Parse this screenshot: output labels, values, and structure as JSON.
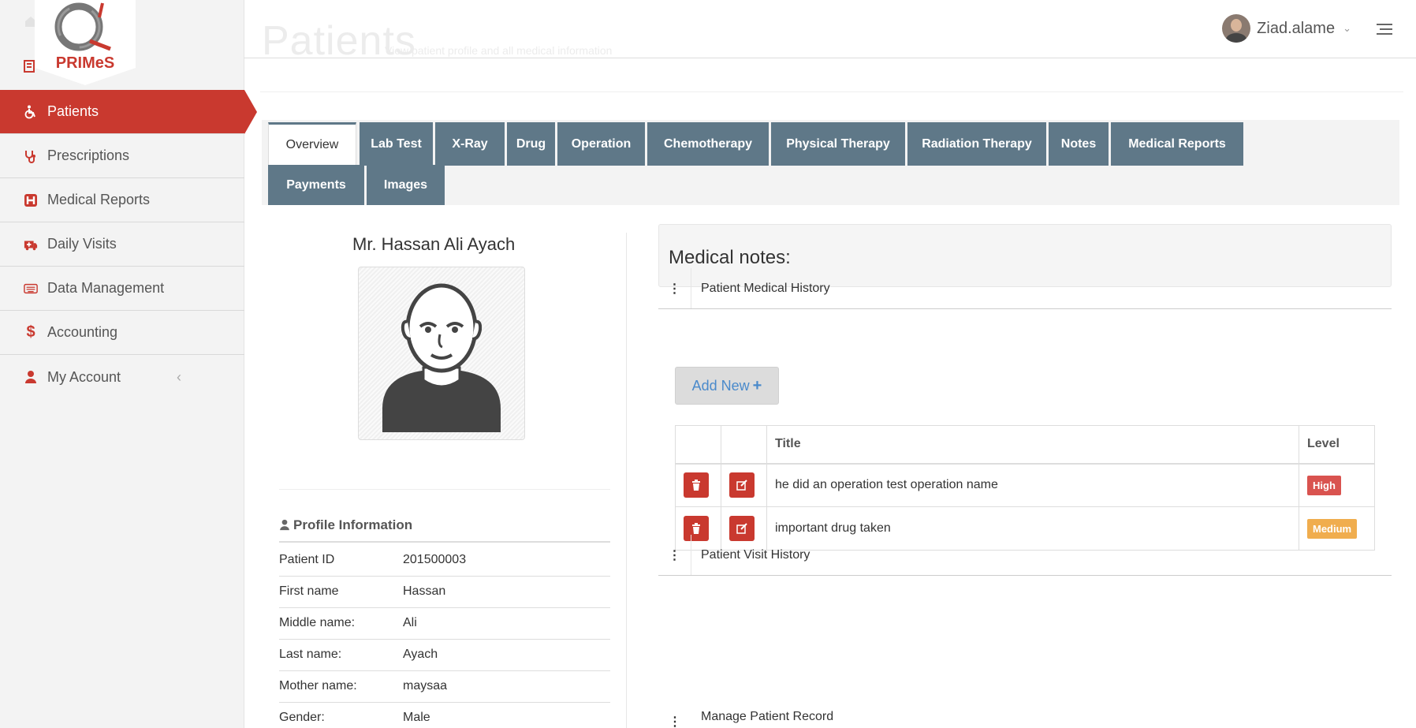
{
  "app": {
    "brand": "PRIMeS"
  },
  "header": {
    "title": "Patients",
    "subtitle": "View patient profile and all medical information",
    "user_name": "Ziad.alame"
  },
  "sidebar": {
    "items": [
      {
        "label": "Patients",
        "icon": "wheelchair-icon",
        "active": true
      },
      {
        "label": "Prescriptions",
        "icon": "stethoscope-icon"
      },
      {
        "label": "Medical Reports",
        "icon": "hospital-icon"
      },
      {
        "label": "Daily Visits",
        "icon": "ambulance-icon"
      },
      {
        "label": "Data Management",
        "icon": "keyboard-icon"
      },
      {
        "label": "Accounting",
        "icon": "dollar-icon"
      },
      {
        "label": "My Account",
        "icon": "user-icon"
      }
    ]
  },
  "tabs": [
    "Overview",
    "Lab Test",
    "X-Ray",
    "Drug",
    "Operation",
    "Chemotherapy",
    "Physical Therapy",
    "Radiation Therapy",
    "Notes",
    "Medical Reports",
    "Payments",
    "Images"
  ],
  "patient": {
    "display_name": "Mr. Hassan Ali Ayach",
    "profile_heading": "Profile Information",
    "fields": [
      {
        "label": "Patient ID",
        "value": "201500003"
      },
      {
        "label": "First name",
        "value": "Hassan"
      },
      {
        "label": "Middle name:",
        "value": "Ali"
      },
      {
        "label": "Last name:",
        "value": "Ayach"
      },
      {
        "label": "Mother name:",
        "value": "maysaa"
      },
      {
        "label": "Gender:",
        "value": "Male"
      }
    ]
  },
  "notes": {
    "heading": "Medical notes:",
    "medical_history_label": "Patient Medical History",
    "add_new_label": "Add New",
    "columns": {
      "title": "Title",
      "level": "Level"
    },
    "rows": [
      {
        "title": "he did an operation test operation name",
        "level": "High",
        "level_color": "#d9534f"
      },
      {
        "title": "important drug taken",
        "level": "Medium",
        "level_color": "#f0ad4e"
      }
    ],
    "visit_history_label": "Patient Visit History",
    "next_section_partial": "Manage Patient Record"
  },
  "colors": {
    "accent": "#c9392f",
    "tab_bg": "#5f7888"
  }
}
